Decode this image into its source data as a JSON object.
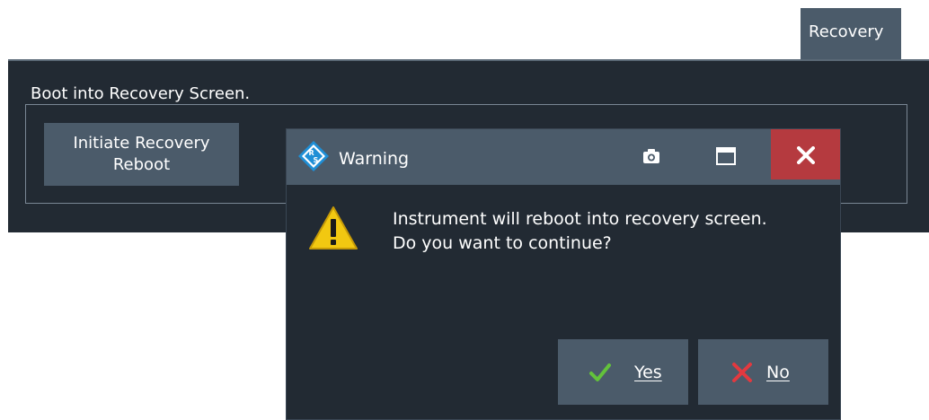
{
  "tab": {
    "label": "Recovery"
  },
  "panel": {
    "title": "Boot into Recovery Screen.",
    "button_line1": "Initiate Recovery",
    "button_line2": "Reboot"
  },
  "dialog": {
    "title": "Warning",
    "message_line1": "Instrument will reboot into recovery screen.",
    "message_line2": "Do you want to continue?",
    "yes_label": "Yes",
    "no_label": "No",
    "icons": {
      "logo": "rohde-schwarz-logo-icon",
      "camera": "camera-icon",
      "maximize": "maximize-icon",
      "close": "close-icon",
      "warning": "warning-icon",
      "yes": "checkmark-icon",
      "no": "cross-icon"
    }
  },
  "colors": {
    "panel_bg": "#222a33",
    "button_bg": "#4b5b6a",
    "close_bg": "#b53a3f",
    "check": "#63c23b",
    "cross": "#e2393f",
    "warning": "#f2c811"
  }
}
